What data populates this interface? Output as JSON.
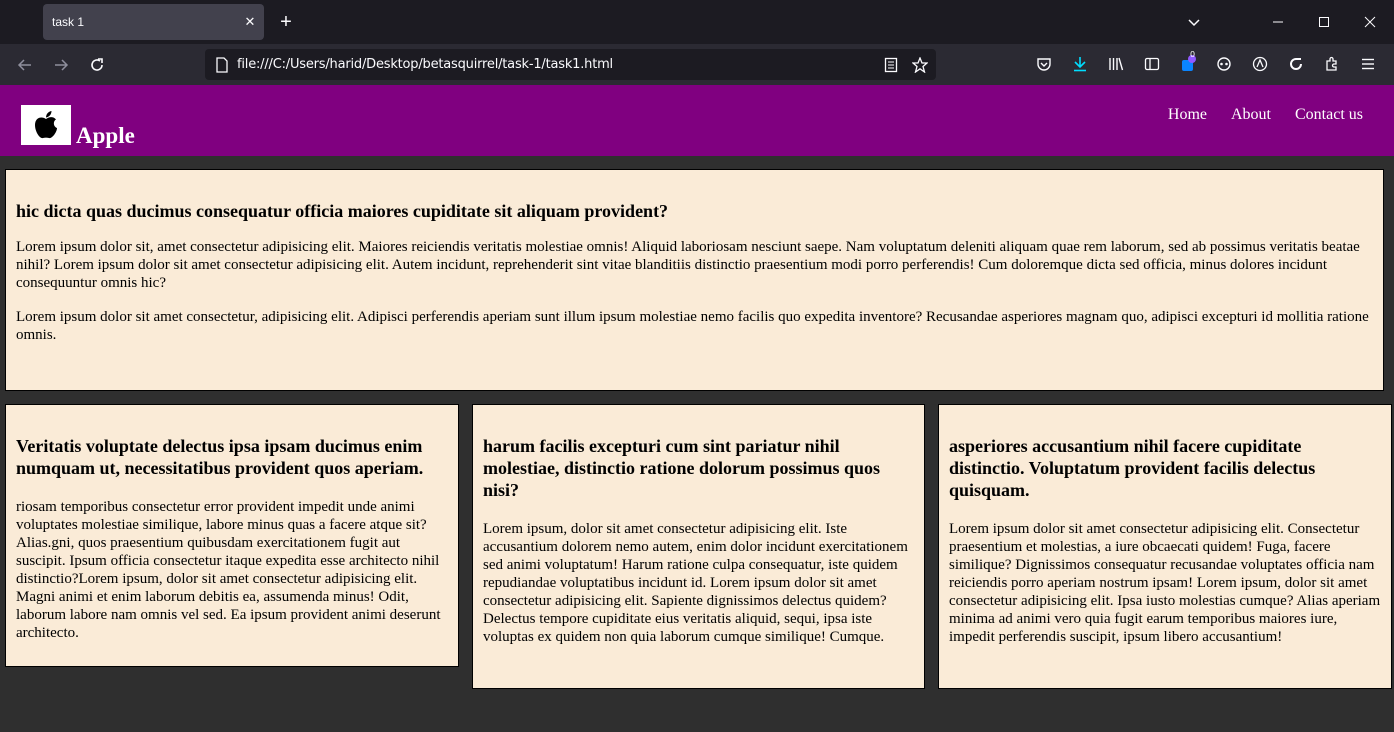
{
  "browser": {
    "tab_title": "task 1",
    "url": "file:///C:/Users/harid/Desktop/betasquirrel/task-1/task1.html",
    "badge_count": "0"
  },
  "site": {
    "brand": "Apple",
    "logo_icon": "apple-logo-icon",
    "nav": [
      "Home",
      "About",
      "Contact us"
    ],
    "colors": {
      "header": "#800080",
      "card": "#faebd7",
      "page_bg": "#2f2f2f"
    }
  },
  "hero": {
    "heading": "hic dicta quas ducimus consequatur officia maiores cupiditate sit aliquam provident?",
    "p1": "Lorem ipsum dolor sit, amet consectetur adipisicing elit. Maiores reiciendis veritatis molestiae omnis! Aliquid laboriosam nesciunt saepe. Nam voluptatum deleniti aliquam quae rem laborum, sed ab possimus veritatis beatae nihil? Lorem ipsum dolor sit amet consectetur adipisicing elit. Autem incidunt, reprehenderit sint vitae blanditiis distinctio praesentium modi porro perferendis! Cum doloremque dicta sed officia, minus dolores incidunt consequuntur omnis hic?",
    "p2": "Lorem ipsum dolor sit amet consectetur, adipisicing elit. Adipisci perferendis aperiam sunt illum ipsum molestiae nemo facilis quo expedita inventore? Recusandae asperiores magnam quo, adipisci excepturi id mollitia ratione omnis."
  },
  "columns": [
    {
      "heading": "Veritatis voluptate delectus ipsa ipsam ducimus enim numquam ut, necessitatibus provident quos aperiam.",
      "body": "riosam temporibus consectetur error provident impedit unde animi voluptates molestiae similique, labore minus quas a facere atque sit? Alias.gni, quos praesentium quibusdam exercitationem fugit aut suscipit. Ipsum officia consectetur itaque expedita esse architecto nihil distinctio?Lorem ipsum, dolor sit amet consectetur adipisicing elit. Magni animi et enim laborum debitis ea, assumenda minus! Odit, laborum labore nam omnis vel sed. Ea ipsum provident animi deserunt architecto."
    },
    {
      "heading": "harum facilis excepturi cum sint pariatur nihil molestiae, distinctio ratione dolorum possimus quos nisi?",
      "body": "Lorem ipsum, dolor sit amet consectetur adipisicing elit. Iste accusantium dolorem nemo autem, enim dolor incidunt exercitationem sed animi voluptatum! Harum ratione culpa consequatur, iste quidem repudiandae voluptatibus incidunt id. Lorem ipsum dolor sit amet consectetur adipisicing elit. Sapiente dignissimos delectus quidem? Delectus tempore cupiditate eius veritatis aliquid, sequi, ipsa iste voluptas ex quidem non quia laborum cumque similique! Cumque."
    },
    {
      "heading": "asperiores accusantium nihil facere cupiditate distinctio. Voluptatum provident facilis delectus quisquam.",
      "body": "Lorem ipsum dolor sit amet consectetur adipisicing elit. Consectetur praesentium et molestias, a iure obcaecati quidem! Fuga, facere similique? Dignissimos consequatur recusandae voluptates officia nam reiciendis porro aperiam nostrum ipsam! Lorem ipsum, dolor sit amet consectetur adipisicing elit. Ipsa iusto molestias cumque? Alias aperiam minima ad animi vero quia fugit earum temporibus maiores iure, impedit perferendis suscipit, ipsum libero accusantium!"
    }
  ]
}
